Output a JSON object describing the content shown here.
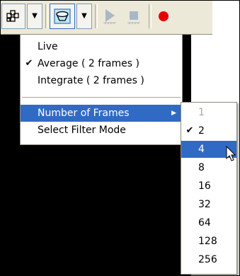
{
  "toolbar": {
    "buttons": [
      {
        "icon": "display-mode-icon"
      },
      {
        "icon": "filter-lens-icon"
      },
      {
        "icon": "play-icon",
        "disabled": true
      },
      {
        "icon": "stop-icon",
        "disabled": true
      },
      {
        "icon": "record-icon",
        "color": "#e60000"
      }
    ],
    "dropdown_arrow": "▼"
  },
  "menu": {
    "items": [
      {
        "label": "Live",
        "checked": false
      },
      {
        "label": "Average  ( 2 frames )",
        "checked": true
      },
      {
        "label": "Integrate  ( 2 frames )",
        "checked": false
      },
      {
        "label": "Number of Frames",
        "submenu": true,
        "highlighted": true
      },
      {
        "label": "Select Filter Mode"
      }
    ],
    "check_glyph": "✔",
    "submenu_glyph": "▶"
  },
  "frames_submenu": {
    "items": [
      {
        "label": "1",
        "disabled": true
      },
      {
        "label": "2",
        "checked": true
      },
      {
        "label": "4",
        "highlighted": true
      },
      {
        "label": "8"
      },
      {
        "label": "16"
      },
      {
        "label": "32"
      },
      {
        "label": "64"
      },
      {
        "label": "128"
      },
      {
        "label": "256"
      }
    ]
  },
  "colors": {
    "highlight": "#316ac5",
    "toolbar_bg": "#ece9d8",
    "record": "#e60000",
    "viewport_bg": "#000000"
  }
}
